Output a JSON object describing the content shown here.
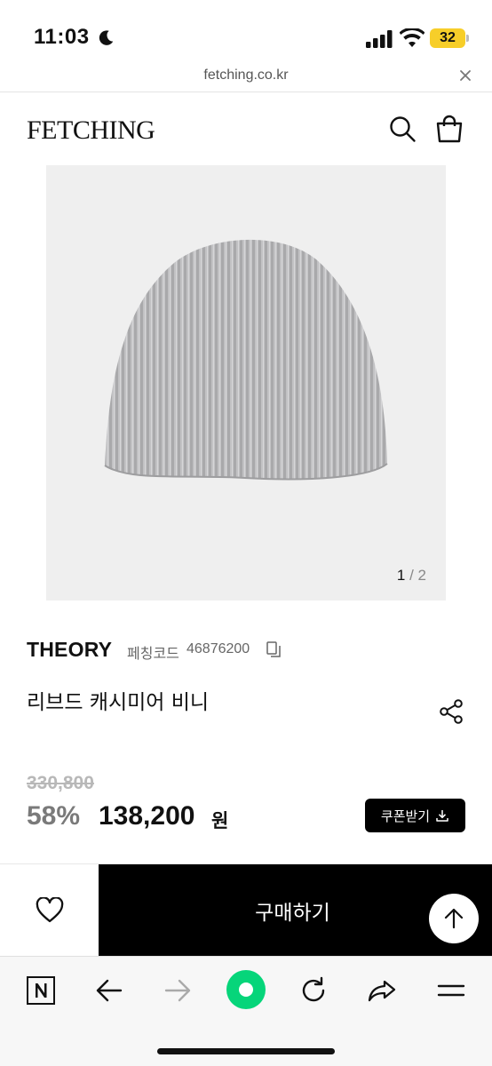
{
  "status_bar": {
    "time": "11:03",
    "battery": "32"
  },
  "browser": {
    "url": "fetching.co.kr"
  },
  "header": {
    "logo": "FETCHING"
  },
  "gallery": {
    "current": "1",
    "separator": "/",
    "total": "2"
  },
  "product": {
    "brand": "THEORY",
    "code_label": "페칭코드",
    "code": "46876200",
    "name": "리브드 캐시미어 비니",
    "original_price": "330,800",
    "discount": "58%",
    "price": "138,200",
    "price_unit": "원",
    "coupon_label": "쿠폰받기"
  },
  "purchase": {
    "buy_label": "구매하기"
  },
  "icons": {
    "status": [
      "moon-icon",
      "signal-icon",
      "wifi-icon"
    ],
    "header": [
      "search-icon",
      "bag-icon"
    ],
    "toolbar": [
      "naver-n-icon",
      "back-arrow-icon",
      "forward-arrow-icon",
      "green-circle-icon",
      "refresh-icon",
      "share-arrow-icon",
      "menu-icon"
    ]
  },
  "colors": {
    "accent_green": "#06d57a",
    "battery": "#f7ce29",
    "buy_button": "#000000",
    "discount": "#7a7a7a"
  }
}
